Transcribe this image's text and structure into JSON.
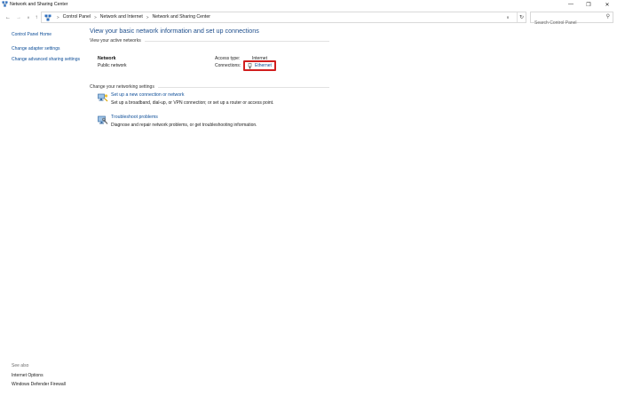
{
  "window": {
    "title": "Network and Sharing Center",
    "minimize": "—",
    "restore": "❐",
    "close": "✕"
  },
  "nav": {
    "back": "←",
    "forward": "→",
    "recent": "∨",
    "up": "↑",
    "breadcrumb": [
      "Control Panel",
      "Network and Internet",
      "Network and Sharing Center"
    ],
    "separator": ">",
    "dropdown": "∨",
    "refresh": "↻",
    "search_placeholder": "Search Control Panel",
    "search_icon": "⚲"
  },
  "sidebar": {
    "home": "Control Panel Home",
    "items": [
      "Change adapter settings",
      "Change advanced sharing settings"
    ]
  },
  "see_also": {
    "title": "See also",
    "items": [
      "Internet Options",
      "Windows Defender Firewall"
    ]
  },
  "main": {
    "title": "View your basic network information and set up connections",
    "active_networks_heading": "View your active networks",
    "network": {
      "name": "Network",
      "type": "Public network",
      "access_type_label": "Access type:",
      "access_type_value": "Internet",
      "connections_label": "Connections:",
      "connection_name": "Ethernet"
    },
    "change_heading": "Change your networking settings",
    "tasks": [
      {
        "link": "Set up a new connection or network",
        "desc": "Set up a broadband, dial-up, or VPN connection; or set up a router or access point.",
        "icon": "new-connection-icon"
      },
      {
        "link": "Troubleshoot problems",
        "desc": "Diagnose and repair network problems, or get troubleshooting information.",
        "icon": "troubleshoot-icon"
      }
    ]
  },
  "colors": {
    "link": "#0b4c97",
    "title": "#1e4e8c",
    "highlight": "#d11f1f"
  }
}
